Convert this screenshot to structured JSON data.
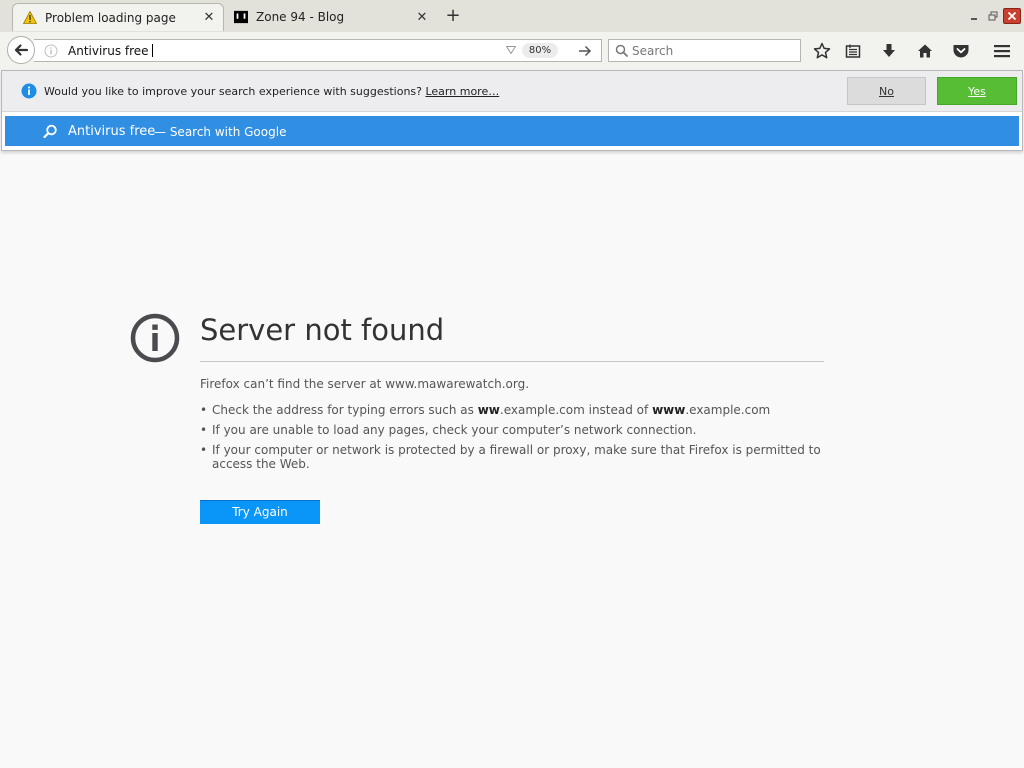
{
  "tabs": [
    {
      "title": "Problem loading page",
      "icon": "warning-icon",
      "active": true,
      "close": "✕"
    },
    {
      "title": "Zone 94 - Blog",
      "icon": "terminal-favicon-icon",
      "active": false,
      "close": "✕"
    }
  ],
  "newtab_label": "+",
  "urlbar": {
    "value": "Antivirus free",
    "zoom": "80%"
  },
  "search": {
    "placeholder": "Search"
  },
  "suggestions_prompt": {
    "text": "Would you like to improve your search experience with suggestions?",
    "learn_more": "Learn more…",
    "no_label": "No",
    "yes_label": "Yes"
  },
  "suggestion_row": {
    "query": "Antivirus free",
    "engine_text": "— Search with Google"
  },
  "error_page": {
    "title": "Server not found",
    "description": "Firefox can’t find the server at www.mawarewatch.org.",
    "item1_pre": "Check the address for typing errors such as ",
    "item1_b1": "ww",
    "item1_mid": ".example.com instead of ",
    "item1_b2": "www",
    "item1_post": ".example.com",
    "item2": "If you are unable to load any pages, check your computer’s network connection.",
    "item3": "If your computer or network is protected by a firewall or proxy, make sure that Firefox is permitted to access the Web.",
    "button": "Try Again"
  },
  "colors": {
    "accent_blue": "#308ee3",
    "yes_green": "#57bd35",
    "button_blue": "#0996f8"
  }
}
